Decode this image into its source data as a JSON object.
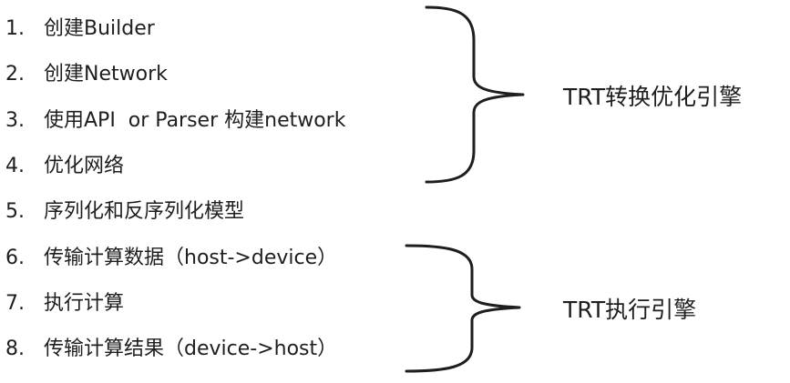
{
  "steps": [
    {
      "number": "1.",
      "text": "创建Builder"
    },
    {
      "number": "2.",
      "text": "创建Network"
    },
    {
      "number": "3.",
      "text": "使用API  or Parser 构建network"
    },
    {
      "number": "4.",
      "text": "优化网络"
    },
    {
      "number": "5.",
      "text": "序列化和反序列化模型"
    },
    {
      "number": "6.",
      "text": "传输计算数据（host->device）"
    },
    {
      "number": "7.",
      "text": "执行计算"
    },
    {
      "number": "8.",
      "text": "传输计算结果（device->host）"
    }
  ],
  "groups": [
    {
      "label": "TRT转换优化引擎",
      "covers_steps": [
        1,
        4
      ]
    },
    {
      "label": "TRT执行引擎",
      "covers_steps": [
        6,
        8
      ]
    }
  ]
}
